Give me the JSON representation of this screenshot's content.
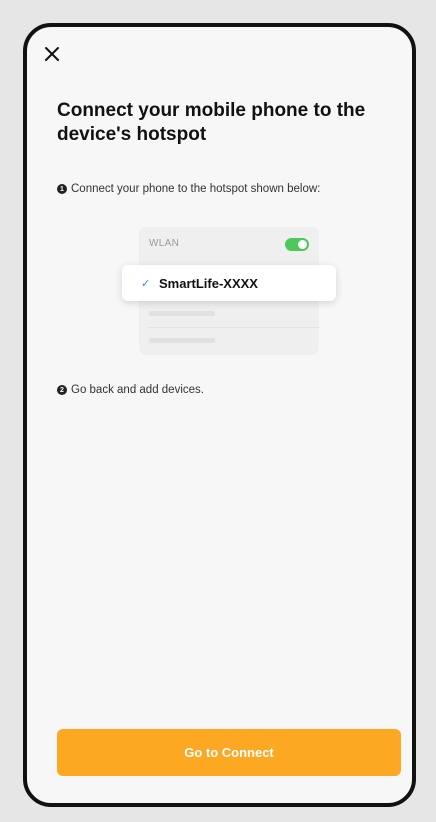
{
  "header": {
    "close_icon": "close-icon"
  },
  "title": "Connect your mobile phone to the device's hotspot",
  "steps": [
    {
      "number": "1",
      "text": "Connect your phone to the hotspot shown below:"
    },
    {
      "number": "2",
      "text": "Go back and add devices."
    }
  ],
  "illustration": {
    "wlan_label": "WLAN",
    "wlan_enabled": true,
    "selected_network": "SmartLife-XXXX",
    "check_icon": "checkmark-icon",
    "toggle_color": "#4cc85a"
  },
  "action": {
    "button_label": "Go to Connect",
    "button_color": "#fca823"
  }
}
